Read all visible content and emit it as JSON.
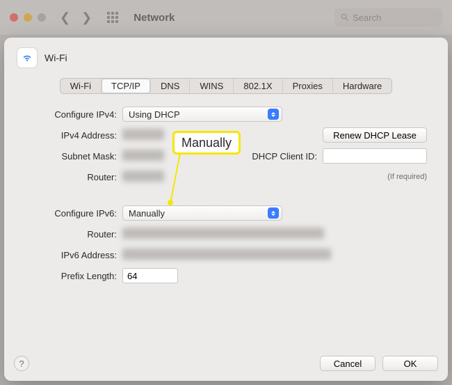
{
  "toolbar": {
    "title": "Network",
    "search_placeholder": "Search"
  },
  "sheet": {
    "title": "Wi-Fi",
    "tabs": [
      "Wi-Fi",
      "TCP/IP",
      "DNS",
      "WINS",
      "802.1X",
      "Proxies",
      "Hardware"
    ],
    "active_tab": "TCP/IP"
  },
  "labels": {
    "configure_ipv4": "Configure IPv4:",
    "ipv4_address": "IPv4 Address:",
    "subnet_mask": "Subnet Mask:",
    "router4": "Router:",
    "configure_ipv6": "Configure IPv6:",
    "router6": "Router:",
    "ipv6_address": "IPv6 Address:",
    "prefix_length": "Prefix Length:",
    "dhcp_client_id": "DHCP Client ID:",
    "if_required": "(If required)"
  },
  "values": {
    "configure_ipv4": "Using DHCP",
    "configure_ipv6": "Manually",
    "prefix_length": "64"
  },
  "buttons": {
    "renew_dhcp": "Renew DHCP Lease",
    "cancel": "Cancel",
    "ok": "OK",
    "help": "?"
  },
  "annotation": {
    "callout": "Manually"
  }
}
